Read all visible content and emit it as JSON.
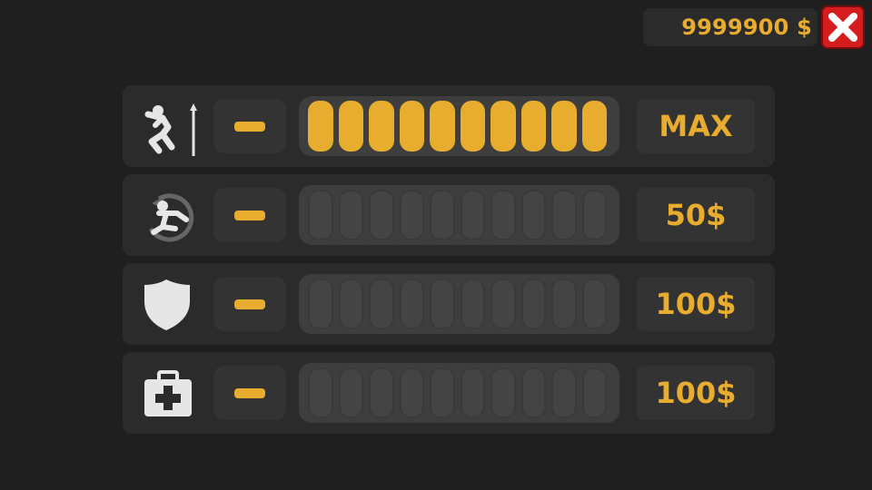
{
  "header": {
    "money": "9999900 $",
    "close_icon": "close-x-icon"
  },
  "colors": {
    "accent": "#e8ad2e",
    "close": "#d51d1d",
    "background": "#1f1f1f",
    "panel": "#2b2b2b"
  },
  "upgrades": [
    {
      "icon": "high-jump-icon",
      "level": 10,
      "max_level": 10,
      "price": "MAX"
    },
    {
      "icon": "roll-respawn-icon",
      "level": 0,
      "max_level": 10,
      "price": "50$"
    },
    {
      "icon": "shield-icon",
      "level": 0,
      "max_level": 10,
      "price": "100$"
    },
    {
      "icon": "medkit-icon",
      "level": 0,
      "max_level": 10,
      "price": "100$"
    }
  ]
}
